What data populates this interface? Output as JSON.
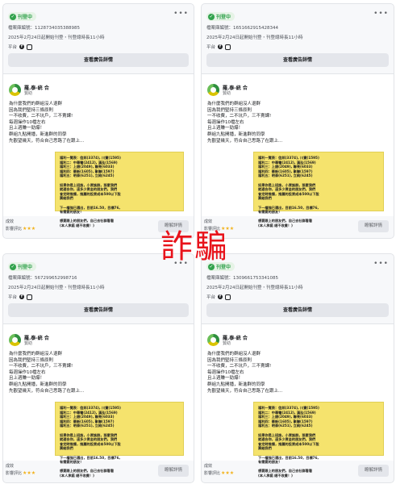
{
  "stamp": "詐騙",
  "common": {
    "status": "刊登中",
    "start": "2025年2月24日起開始刊登・刊登總時長11小時",
    "platforms_label": "平台",
    "details_button": "查看廣告詳情",
    "advertiser": "羅.泰-統 合",
    "sponsored": "贊助",
    "body_lines": [
      "為什麼我們的群組沒人退群",
      "因為我們堅持三條原則",
      "一不收費，二不坑戶，三不賣課!",
      "每週操作10檔左右",
      "且上週賺一勁爆！",
      "群組九點開播，新進群的同學",
      "先觀望幾天，符合自己思路了在跟上..."
    ],
    "image_lines": [
      "福利一覽表：信邦(3374), 川寶(1595)",
      "福利二：中華電(2412), 漢泓(1569)",
      "福利三：上銀(2049), 聯亮(6033)",
      "福利四：華新(1605), 聚聯(1597)",
      "福利五：明泰(6251), 立純(6245)",
      "",
      "如果你是上班族，小資族群，那麼我們",
      "就適合你，這多少資金的朋友們，我們",
      "會定時推播，推薦的投資成本500以下股",
      "票給我們",
      "",
      "下一檔強已選出，目前16.50，目標76,",
      "有需要的朋友！",
      "",
      "想要跟上的朋友們，自己去社群看看",
      "(本人承諾 絕不收費！)"
    ],
    "stat_label": "成效",
    "stat_rating_label": "影響評比",
    "stars": "★★★",
    "open_button": "瞭解詳情"
  },
  "cards": [
    {
      "id_label": "檔案庫編號：1128734035388985"
    },
    {
      "id_label": "檔案庫編號：1651662915428344"
    },
    {
      "id_label": "檔案庫編號：567299652998716"
    },
    {
      "id_label": "檔案庫編號：1309661753341085"
    }
  ]
}
